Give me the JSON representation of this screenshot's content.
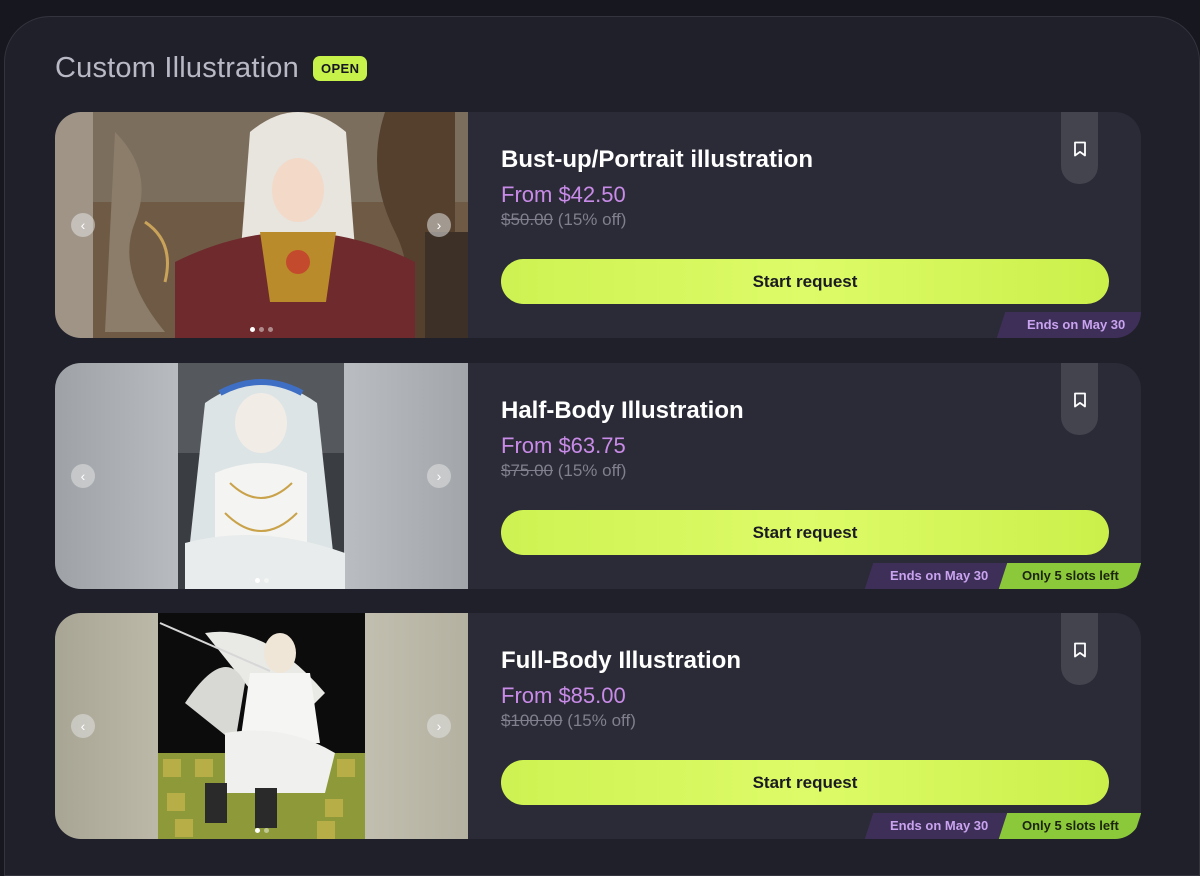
{
  "page": {
    "title": "Custom Illustration",
    "status_badge": "OPEN"
  },
  "colors": {
    "background": "#20202b",
    "card": "#2b2b37",
    "accent_lime": "#cef252",
    "price_purple": "#c98be8",
    "ends_tag": "#3e2f58",
    "slots_tag": "#8cc93a"
  },
  "cards": [
    {
      "name": "Bust-up/Portrait illustration",
      "price": "From $42.50",
      "original_price": "$50.00",
      "discount": "(15% off)",
      "button_label": "Start request",
      "ends_label": "Ends on May 30",
      "slots_label": "",
      "bookmark_icon": "bookmark-icon",
      "carousel_dots": 3,
      "active_dot": 1
    },
    {
      "name": "Half-Body Illustration",
      "price": "From $63.75",
      "original_price": "$75.00",
      "discount": "(15% off)",
      "button_label": "Start request",
      "ends_label": "Ends on May 30",
      "slots_label": "Only 5 slots left",
      "bookmark_icon": "bookmark-icon",
      "carousel_dots": 2,
      "active_dot": 1
    },
    {
      "name": "Full-Body Illustration",
      "price": "From $85.00",
      "original_price": "$100.00",
      "discount": "(15% off)",
      "button_label": "Start request",
      "ends_label": "Ends on May 30",
      "slots_label": "Only 5 slots left",
      "bookmark_icon": "bookmark-icon",
      "carousel_dots": 2,
      "active_dot": 1
    }
  ],
  "carousel_icons": {
    "prev": "‹",
    "next": "›"
  }
}
